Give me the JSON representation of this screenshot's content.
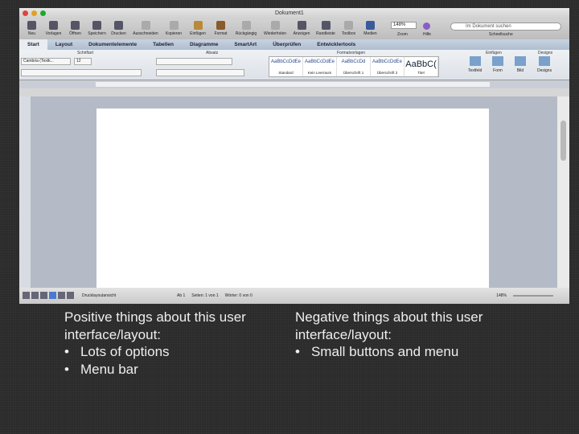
{
  "window": {
    "title": "Dokument1"
  },
  "toolbar": {
    "buttons": [
      "Neu",
      "Vorlagen",
      "Öffnen",
      "Speichern",
      "Drucken",
      "Ausschneiden",
      "Kopieren",
      "Einfügen",
      "Format",
      "Rückgängig",
      "Wiederholen",
      "Anzeigen",
      "Randleiste",
      "Toolbox",
      "Medien"
    ],
    "zoom_value": "148%",
    "zoom_label": "Zoom",
    "help_label": "Hilfe",
    "search_placeholder": "Im Dokument suchen",
    "search_label": "Schnellsuche"
  },
  "tabs": [
    "Start",
    "Layout",
    "Dokumentelemente",
    "Tabellen",
    "Diagramme",
    "SmartArt",
    "Überprüfen",
    "Entwicklertools"
  ],
  "ribbon": {
    "groups": [
      "Schriftart",
      "Absatz",
      "Formatvorlagen",
      "Einfügen",
      "Designs"
    ],
    "font": "Cambria (Textk...",
    "size": "12",
    "styles": [
      {
        "preview": "AaBbCcDdEe",
        "name": "Standard"
      },
      {
        "preview": "AaBbCcDdEe",
        "name": "Kein Leerraum"
      },
      {
        "preview": "AaBbCcDd",
        "name": "Überschrift 1"
      },
      {
        "preview": "AaBbCcDdEe",
        "name": "Überschrift 2"
      },
      {
        "preview": "AaBbC(",
        "name": "Titel"
      }
    ],
    "insert": [
      "Textfeld",
      "Form",
      "Bild",
      "Designs"
    ]
  },
  "status": {
    "view": "Drucklayoutansicht",
    "section": "Ab 1",
    "pages": "Seiten: 1 von 1",
    "words": "Wörter: 0 von 0",
    "zoom": "148%"
  },
  "slide": {
    "positive_heading": "Positive things about this user interface/layout:",
    "positive": [
      "Lots of options",
      "Menu bar"
    ],
    "negative_heading": "Negative things about this user interface/layout:",
    "negative": [
      "Small buttons and menu"
    ]
  }
}
